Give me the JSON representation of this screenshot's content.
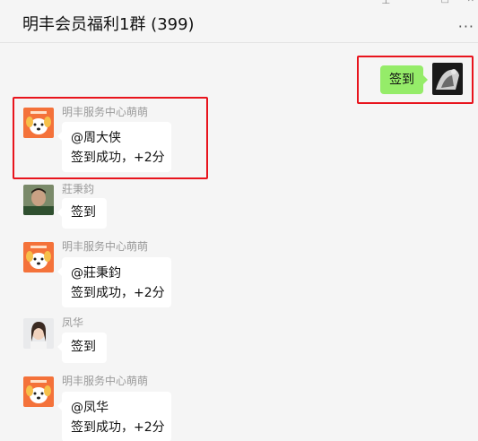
{
  "window": {
    "title": "明丰会员福利1群 (399)",
    "more_icon": "more-icon",
    "control_icons": [
      "pin-icon",
      "minimize-icon",
      "maximize-icon",
      "close-icon"
    ]
  },
  "colors": {
    "self_bubble": "#95ec69",
    "other_bubble": "#ffffff",
    "highlight_box": "#e8141d",
    "bot_avatar_bg": "#f4723a"
  },
  "messages": [
    {
      "side": "right",
      "sender": "",
      "lines": [
        "签到"
      ]
    },
    {
      "side": "left",
      "sender": "明丰服务中心萌萌",
      "lines": [
        "@周大侠",
        "签到成功，+2分"
      ]
    },
    {
      "side": "left",
      "sender": "莊秉鈞",
      "lines": [
        "签到"
      ]
    },
    {
      "side": "left",
      "sender": "明丰服务中心萌萌",
      "lines": [
        "@莊秉鈞",
        "签到成功，+2分"
      ]
    },
    {
      "side": "left",
      "sender": "凤华",
      "lines": [
        "签到"
      ]
    },
    {
      "side": "left",
      "sender": "明丰服务中心萌萌",
      "lines": [
        "@凤华",
        "签到成功，+2分"
      ]
    }
  ]
}
